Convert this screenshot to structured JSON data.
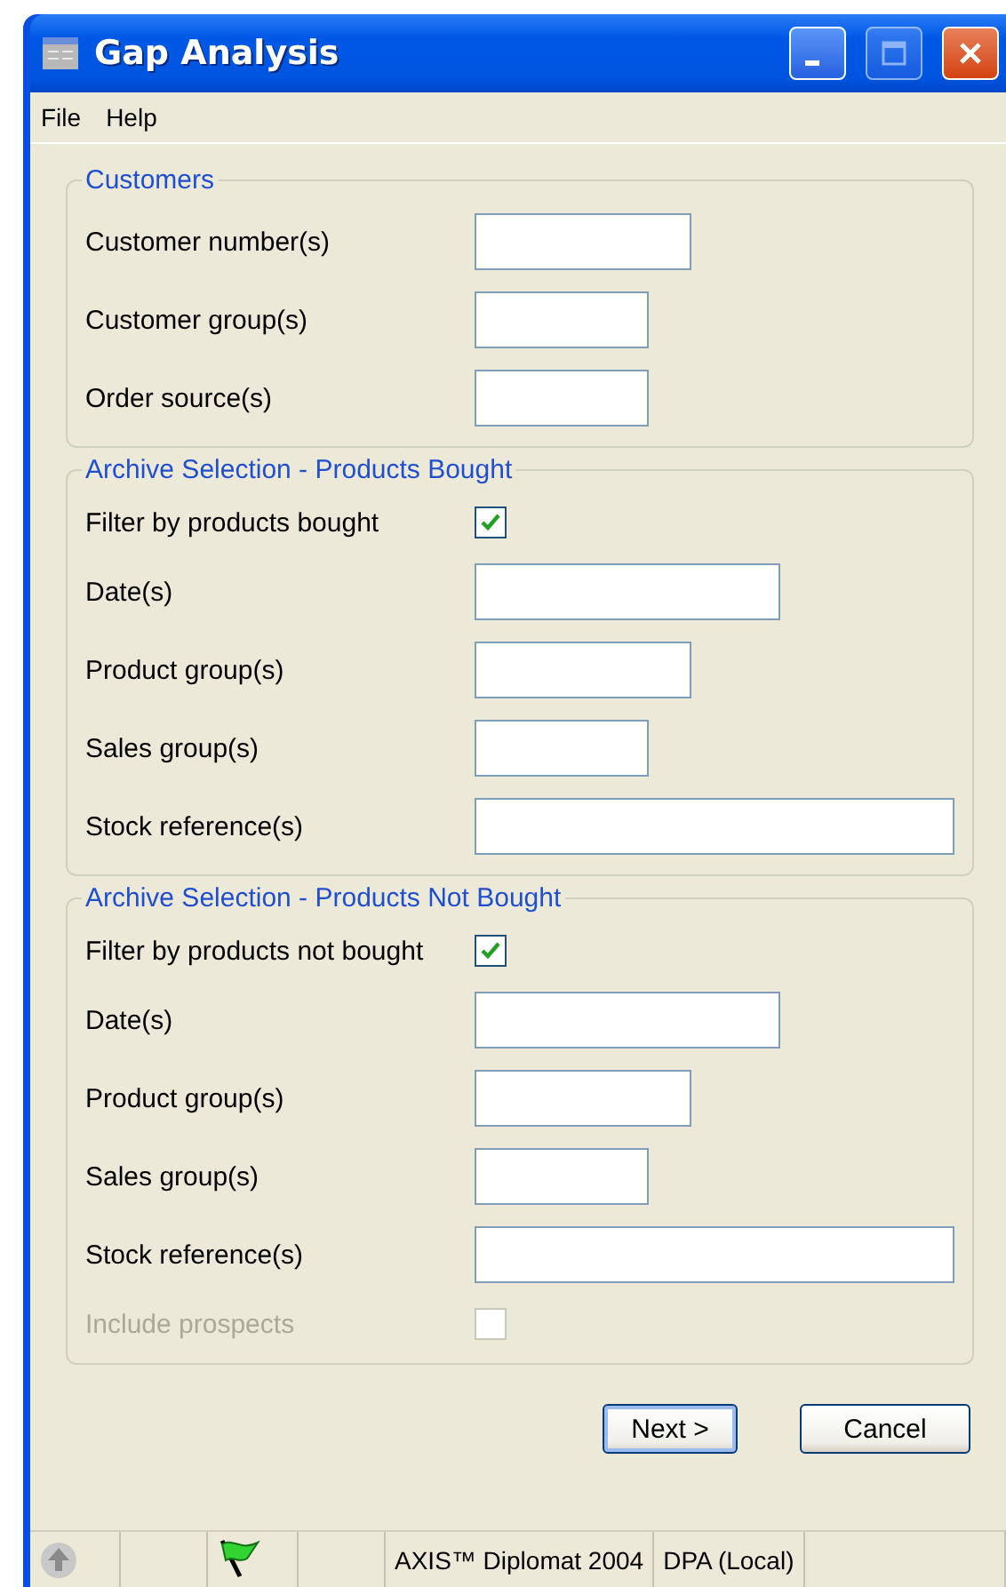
{
  "window": {
    "title": "Gap Analysis",
    "controls": [
      {
        "kind": "minimize",
        "disabled": false
      },
      {
        "kind": "maximize",
        "disabled": true
      },
      {
        "kind": "close",
        "disabled": false
      }
    ]
  },
  "menu": [
    {
      "label": "File"
    },
    {
      "label": "Help"
    }
  ],
  "groups": [
    {
      "title": "Customers",
      "rows": [
        {
          "kind": "text",
          "label": "Customer number(s)",
          "disabled": false
        },
        {
          "kind": "text",
          "label": "Customer group(s)",
          "disabled": false
        },
        {
          "kind": "text",
          "label": "Order source(s)",
          "disabled": false
        }
      ]
    },
    {
      "title": "Archive Selection - Products Bought",
      "rows": [
        {
          "kind": "checkbox",
          "label": "Filter by products bought",
          "checked": true,
          "disabled": false
        },
        {
          "kind": "text",
          "label": "Date(s)",
          "disabled": false
        },
        {
          "kind": "text",
          "label": "Product group(s)",
          "disabled": false
        },
        {
          "kind": "text",
          "label": "Sales group(s)",
          "disabled": false
        },
        {
          "kind": "text",
          "label": "Stock reference(s)",
          "disabled": false
        }
      ]
    },
    {
      "title": "Archive Selection - Products Not Bought",
      "rows": [
        {
          "kind": "checkbox",
          "label": "Filter by products not bought",
          "checked": true,
          "disabled": false
        },
        {
          "kind": "text",
          "label": "Date(s)",
          "disabled": false
        },
        {
          "kind": "text",
          "label": "Product group(s)",
          "disabled": false
        },
        {
          "kind": "text",
          "label": "Sales group(s)",
          "disabled": false
        },
        {
          "kind": "text",
          "label": "Stock reference(s)",
          "disabled": false
        },
        {
          "kind": "checkbox",
          "label": "Include prospects",
          "checked": false,
          "disabled": true
        }
      ]
    }
  ],
  "buttons": [
    {
      "label": "Next >",
      "default": true
    },
    {
      "label": "Cancel",
      "default": false
    }
  ],
  "status_bar": [
    {
      "kind": "up-icon"
    },
    {
      "kind": "empty"
    },
    {
      "kind": "flag-icon"
    },
    {
      "kind": "empty"
    },
    {
      "kind": "text",
      "text": "AXIS™ Diplomat 2004"
    },
    {
      "kind": "text",
      "text": "DPA (Local)"
    },
    {
      "kind": "empty"
    }
  ]
}
